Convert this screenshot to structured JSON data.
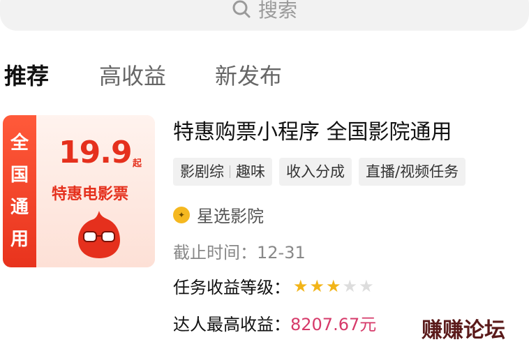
{
  "search": {
    "placeholder": "搜索",
    "icon": "search-icon"
  },
  "tabs": [
    {
      "label": "推荐",
      "active": true
    },
    {
      "label": "高收益",
      "active": false
    },
    {
      "label": "新发布",
      "active": false
    }
  ],
  "task": {
    "poster": {
      "strip_text": [
        "全",
        "国",
        "通",
        "用"
      ],
      "price": "19.9",
      "price_suffix": "起",
      "subtitle": "特惠电影票",
      "mascot_icon": "glasses-mascot-icon"
    },
    "title": "特惠购票小程序 全国影院通用",
    "tags": [
      {
        "parts": [
          "影剧综",
          "趣味"
        ]
      },
      {
        "parts": [
          "收入分成"
        ]
      },
      {
        "parts": [
          "直播/视频任务"
        ]
      }
    ],
    "cinema": {
      "name": "星选影院",
      "logo_icon": "cinema-logo-icon"
    },
    "deadline": "截止时间：12-31",
    "level": {
      "label": "任务收益等级：",
      "stars_filled": 3,
      "stars_total": 5
    },
    "max_income": {
      "label": "达人最高收益：",
      "value": "8207.67元"
    }
  },
  "watermark": "赚赚论坛",
  "colors": {
    "accent_red": "#e5301d",
    "star_gold": "#f2b418",
    "star_empty": "#dddddd",
    "income_pink": "#d63a6a"
  }
}
